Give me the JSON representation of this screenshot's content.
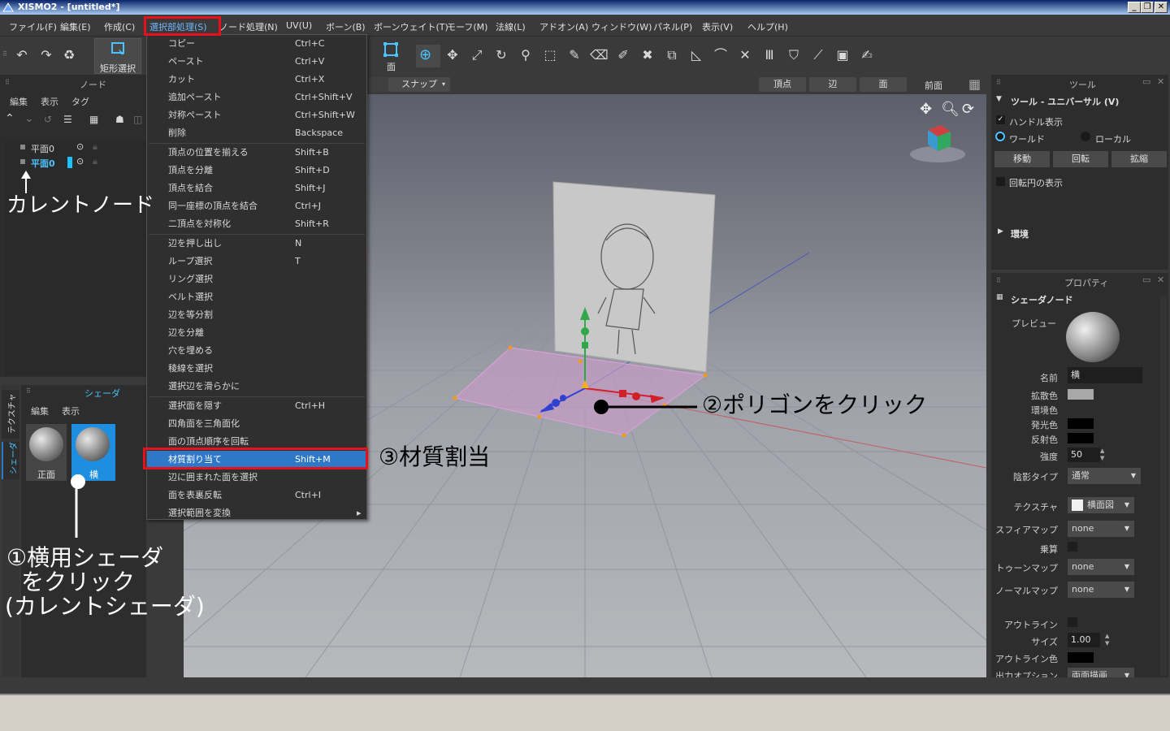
{
  "window": {
    "title": "XISMO2 - [untitled*]"
  },
  "menubar": [
    "ファイル(F)",
    "編集(E)",
    "作成(C)",
    "選択部処理(S)",
    "ノード処理(N)",
    "UV(U)",
    "ボーン(B)",
    "ボーンウェイト(T)",
    "モーフ(M)",
    "法線(L)",
    "アドオン(A)",
    "ウィンドウ(W)",
    "パネル(P)",
    "表示(V)",
    "ヘルプ(H)"
  ],
  "toolbar": {
    "rect_select": "矩形選択",
    "face_label": "面"
  },
  "dropdown": [
    {
      "label": "コピー",
      "shortcut": "Ctrl+C"
    },
    {
      "label": "ペースト",
      "shortcut": "Ctrl+V"
    },
    {
      "label": "カット",
      "shortcut": "Ctrl+X"
    },
    {
      "label": "追加ペースト",
      "shortcut": "Ctrl+Shift+V"
    },
    {
      "label": "対称ペースト",
      "shortcut": "Ctrl+Shift+W"
    },
    {
      "label": "削除",
      "shortcut": "Backspace"
    },
    {
      "label": "頂点の位置を揃える",
      "shortcut": "Shift+B"
    },
    {
      "label": "頂点を分離",
      "shortcut": "Shift+D"
    },
    {
      "label": "頂点を結合",
      "shortcut": "Shift+J"
    },
    {
      "label": "同一座標の頂点を結合",
      "shortcut": "Ctrl+J"
    },
    {
      "label": "二頂点を対称化",
      "shortcut": "Shift+R"
    },
    {
      "label": "辺を押し出し",
      "shortcut": "N"
    },
    {
      "label": "ループ選択",
      "shortcut": "T"
    },
    {
      "label": "リング選択",
      "shortcut": ""
    },
    {
      "label": "ベルト選択",
      "shortcut": ""
    },
    {
      "label": "辺を等分割",
      "shortcut": ""
    },
    {
      "label": "辺を分離",
      "shortcut": ""
    },
    {
      "label": "穴を埋める",
      "shortcut": ""
    },
    {
      "label": "稜線を選択",
      "shortcut": ""
    },
    {
      "label": "選択辺を滑らかに",
      "shortcut": ""
    },
    {
      "label": "選択面を隠す",
      "shortcut": "Ctrl+H"
    },
    {
      "label": "四角面を三角面化",
      "shortcut": ""
    },
    {
      "label": "面の頂点順序を回転",
      "shortcut": ""
    },
    {
      "label": "材質割り当て",
      "shortcut": "Shift+M"
    },
    {
      "label": "辺に囲まれた面を選択",
      "shortcut": ""
    },
    {
      "label": "面を表裏反転",
      "shortcut": "Ctrl+I"
    },
    {
      "label": "選択範囲を変換",
      "shortcut": "▸"
    }
  ],
  "node_panel": {
    "title": "ノード",
    "menu": [
      "編集",
      "表示",
      "タグ"
    ],
    "nodes": [
      "平面0",
      "平面0"
    ]
  },
  "shader_panel": {
    "title": "シェーダ",
    "menu": [
      "編集",
      "表示"
    ],
    "items": [
      "正面",
      "横"
    ],
    "side_tabs": [
      "テクスチャ",
      "シェーダ"
    ]
  },
  "viewport": {
    "snap": "スナップ",
    "modes": [
      "頂点",
      "辺",
      "面"
    ],
    "view": "前面"
  },
  "tool_panel": {
    "title": "ツール",
    "section": "ツール - ユニバーサル (V)",
    "handle": "ハンドル表示",
    "world": "ワールド",
    "local": "ローカル",
    "buttons": [
      "移動",
      "回転",
      "拡縮"
    ],
    "rotate_circle": "回転円の表示",
    "env": "環境"
  },
  "props_panel": {
    "title": "プロパティ",
    "section": "シェーダノード",
    "preview": "プレビュー",
    "name_label": "名前",
    "name_value": "横",
    "diffuse": "拡散色",
    "ambient": "環境色",
    "emissive": "発光色",
    "specular": "反射色",
    "strength": "強度",
    "strength_value": "50",
    "shade_type": "陰影タイプ",
    "shade_value": "通常",
    "texture": "テクスチャ",
    "texture_value": "横面図",
    "sphere": "スフィアマップ",
    "sphere_value": "none",
    "multiply": "乗算",
    "toon": "トゥーンマップ",
    "toon_value": "none",
    "normal": "ノーマルマップ",
    "normal_value": "none",
    "outline": "アウトライン",
    "size": "サイズ",
    "size_value": "1.00",
    "outline_color": "アウトライン色",
    "output": "出力オプション",
    "output_value": "両面描画"
  },
  "annotations": {
    "current_node": "カレントノード",
    "step1_l1": "①横用シェーダ",
    "step1_l2": "をクリック",
    "step1_l3": "(カレントシェーダ)",
    "step2": "②ポリゴンをクリック",
    "step3": "③材質割当"
  },
  "colors": {
    "accent": "#2e78c8",
    "highlight_red": "#e8101a",
    "diffuse": "#a8a8a8",
    "ambient": "#2d2d2d",
    "emissive": "#000000",
    "specular": "#000000"
  }
}
